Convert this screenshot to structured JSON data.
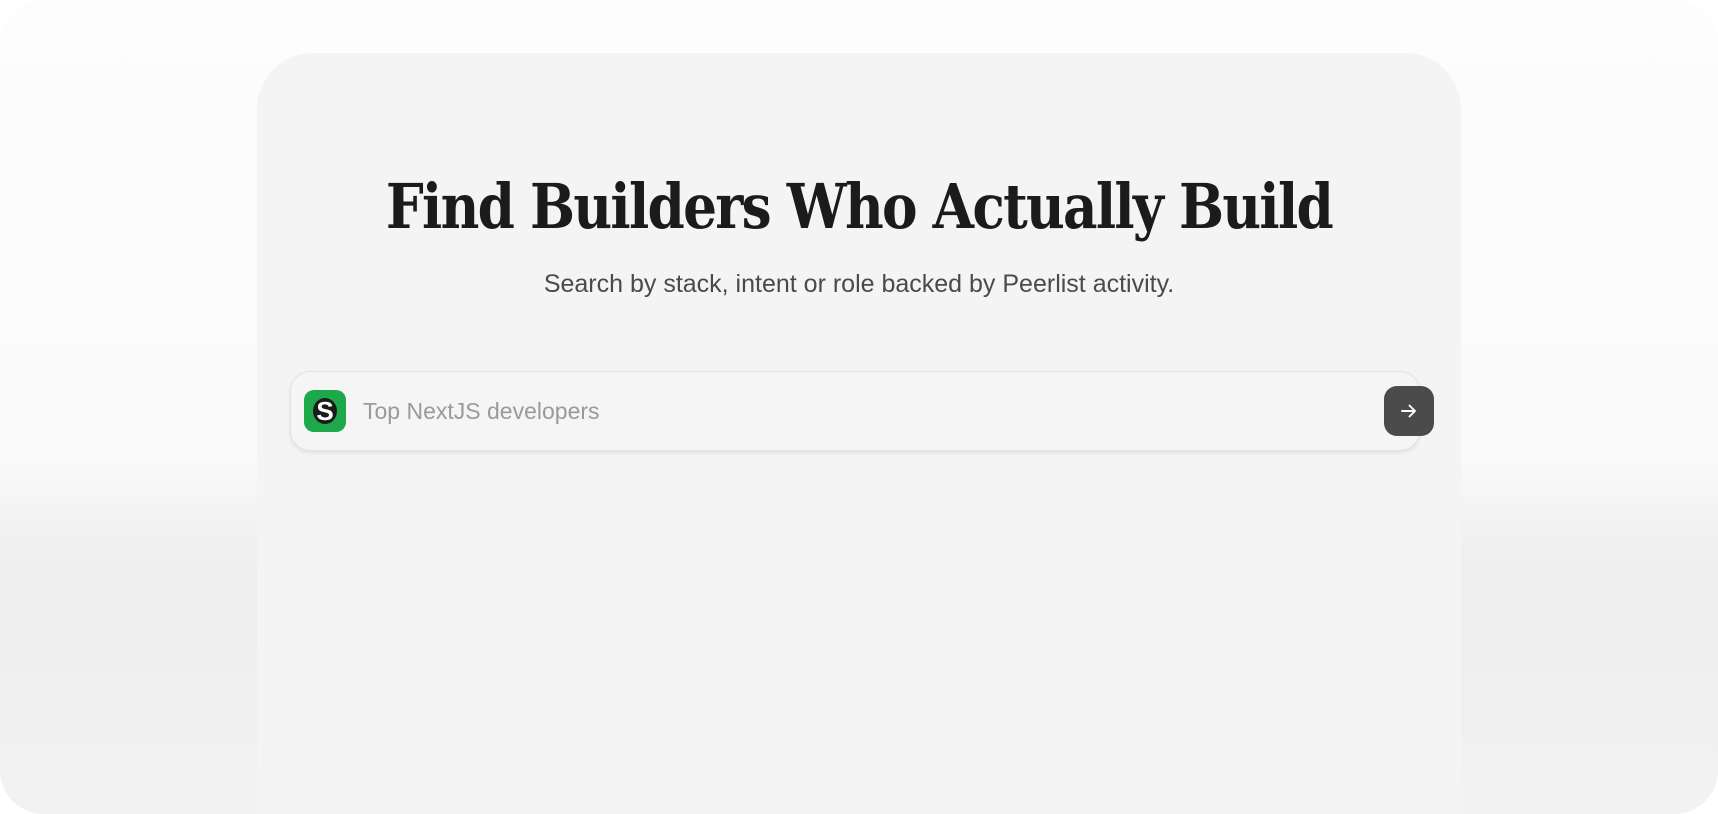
{
  "hero": {
    "title": "Find Builders Who Actually Build",
    "subtitle": "Search by stack, intent or role backed by Peerlist activity."
  },
  "search": {
    "placeholder": "Top NextJS developers",
    "value": "",
    "logo_letter": "S",
    "logo_color": "#1da94a",
    "submit_icon": "arrow-right-icon",
    "submit_color": "#4b4b4b"
  }
}
